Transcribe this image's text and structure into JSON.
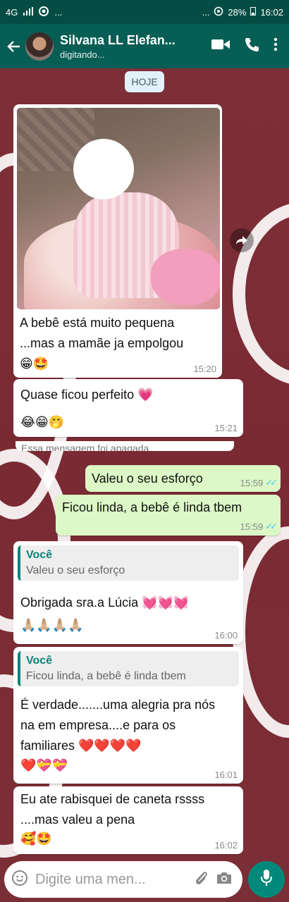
{
  "status_bar": {
    "network": "4G",
    "dots_left": "...",
    "dots_right": "...",
    "battery": "28%",
    "time": "16:02"
  },
  "header": {
    "contact_name": "Silvana LL Elefan...",
    "contact_status": "digitando..."
  },
  "day_chip": "HOJE",
  "messages": [
    {
      "text": "A bebê está muito pequena ...mas a mamãe ja empolgou 😁🤩",
      "time": "15:20"
    },
    {
      "text": "Quase ficou perfeito 💗",
      "text2": "😂😁🤭",
      "time": "15:21"
    },
    {
      "text": "Essa mensagem foi apagada"
    },
    {
      "text": "Valeu o seu esforço",
      "time": "15:59"
    },
    {
      "text": "Ficou linda, a bebê é linda tbem",
      "time": "15:59"
    },
    {
      "quote_author": "Você",
      "quote_text": "Valeu o seu esforço",
      "text": "Obrigada sra.a Lúcia 💓💓💓",
      "text2": "🙏🏼🙏🏼🙏🏼🙏🏼",
      "time": "16:00"
    },
    {
      "quote_author": "Você",
      "quote_text": "Ficou linda, a bebê é linda tbem",
      "text": "É verdade.......uma alegria pra nós na em empresa....e para os familiares ❤️❤️❤️❤️",
      "text2": "❤️💝💝",
      "time": "16:01"
    },
    {
      "text": "Eu ate rabisquei de caneta rssss ....mas valeu a pena",
      "text2": "🥰🤩",
      "time": "16:02"
    }
  ],
  "input": {
    "placeholder": "Digite uma men..."
  },
  "icons": {
    "back": "arrow-back-icon",
    "video": "video-call-icon",
    "call": "phone-icon",
    "menu": "more-vert-icon",
    "forward": "forward-icon",
    "emoji": "emoji-icon",
    "attach": "paperclip-icon",
    "camera": "camera-icon",
    "mic": "mic-icon"
  },
  "colors": {
    "header": "#075e54",
    "status_bar": "#054d44",
    "outgoing_bubble": "#dcf8c6",
    "incoming_bubble": "#ffffff",
    "quote_accent": "#07847a",
    "mic_button": "#00897b",
    "read_ticks": "#4fc3f7"
  }
}
